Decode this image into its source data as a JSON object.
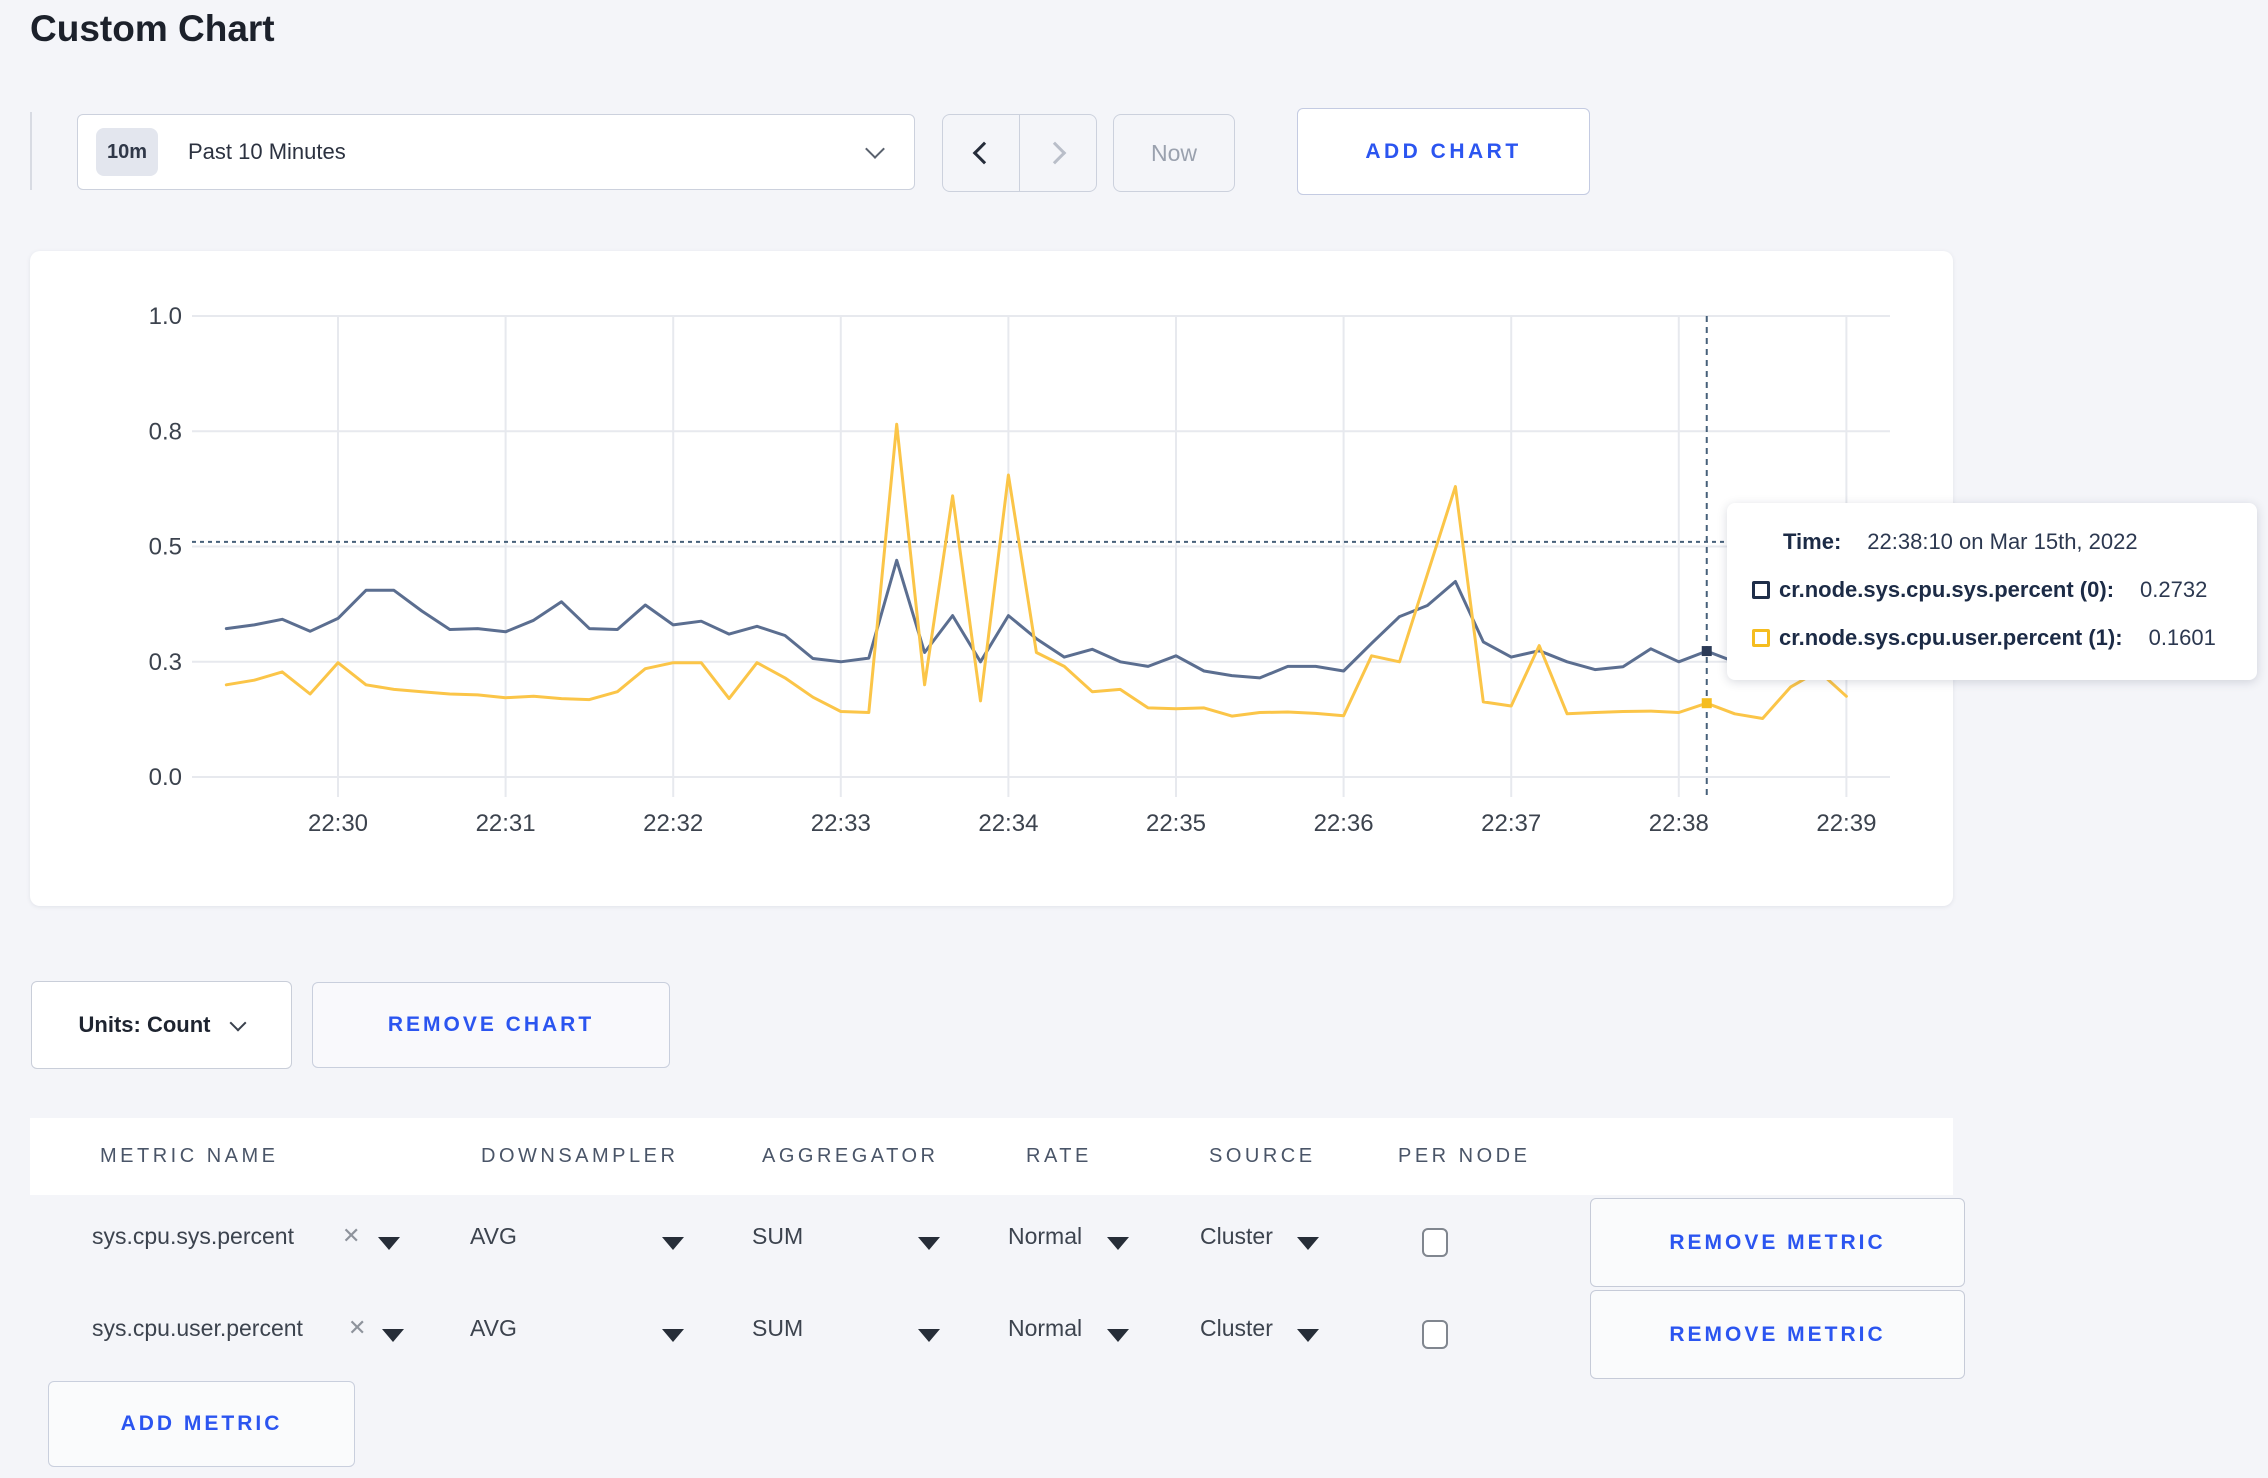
{
  "title": "Custom Chart",
  "toolbar": {
    "range_badge": "10m",
    "range_label": "Past 10 Minutes",
    "now_label": "Now",
    "add_chart_label": "ADD CHART"
  },
  "chart_data": {
    "type": "line",
    "title": "",
    "xlabel": "",
    "ylabel": "",
    "ylim": [
      0,
      1.0
    ],
    "grid": true,
    "yticks": [
      {
        "v": 0.0,
        "label": "0.0"
      },
      {
        "v": 0.25,
        "label": "0.3"
      },
      {
        "v": 0.5,
        "label": "0.5"
      },
      {
        "v": 0.75,
        "label": "0.8"
      },
      {
        "v": 1.0,
        "label": "1.0"
      }
    ],
    "xticks": [
      "22:30",
      "22:31",
      "22:32",
      "22:33",
      "22:34",
      "22:35",
      "22:36",
      "22:37",
      "22:38",
      "22:39"
    ],
    "x": [
      "22:29:20",
      "22:29:30",
      "22:29:40",
      "22:29:50",
      "22:30:00",
      "22:30:10",
      "22:30:20",
      "22:30:30",
      "22:30:40",
      "22:30:50",
      "22:31:00",
      "22:31:10",
      "22:31:20",
      "22:31:30",
      "22:31:40",
      "22:31:50",
      "22:32:00",
      "22:32:10",
      "22:32:20",
      "22:32:30",
      "22:32:40",
      "22:32:50",
      "22:33:00",
      "22:33:10",
      "22:33:20",
      "22:33:30",
      "22:33:40",
      "22:33:50",
      "22:34:00",
      "22:34:10",
      "22:34:20",
      "22:34:30",
      "22:34:40",
      "22:34:50",
      "22:35:00",
      "22:35:10",
      "22:35:20",
      "22:35:30",
      "22:35:40",
      "22:35:50",
      "22:36:00",
      "22:36:10",
      "22:36:20",
      "22:36:30",
      "22:36:40",
      "22:36:50",
      "22:37:00",
      "22:37:10",
      "22:37:20",
      "22:37:30",
      "22:37:40",
      "22:37:50",
      "22:38:00",
      "22:38:10",
      "22:38:20",
      "22:38:30",
      "22:38:40",
      "22:38:50",
      "22:39:00"
    ],
    "series": [
      {
        "name": "cr.node.sys.cpu.sys.percent",
        "color": "#5b6e90",
        "values": [
          0.322,
          0.33,
          0.342,
          0.316,
          0.344,
          0.405,
          0.405,
          0.36,
          0.32,
          0.322,
          0.315,
          0.34,
          0.38,
          0.322,
          0.32,
          0.373,
          0.33,
          0.338,
          0.31,
          0.327,
          0.307,
          0.257,
          0.25,
          0.258,
          0.47,
          0.27,
          0.35,
          0.25,
          0.35,
          0.3,
          0.26,
          0.277,
          0.25,
          0.24,
          0.263,
          0.23,
          0.22,
          0.215,
          0.24,
          0.24,
          0.23,
          0.29,
          0.348,
          0.372,
          0.424,
          0.293,
          0.26,
          0.274,
          0.25,
          0.233,
          0.239,
          0.278,
          0.25,
          0.2732,
          0.25,
          0.26,
          0.27,
          0.265,
          0.27
        ]
      },
      {
        "name": "cr.node.sys.cpu.user.percent",
        "color": "#fbc548",
        "values": [
          0.2,
          0.21,
          0.228,
          0.18,
          0.248,
          0.2,
          0.19,
          0.185,
          0.18,
          0.178,
          0.172,
          0.175,
          0.17,
          0.168,
          0.185,
          0.235,
          0.248,
          0.248,
          0.17,
          0.248,
          0.215,
          0.173,
          0.142,
          0.14,
          0.765,
          0.2,
          0.61,
          0.165,
          0.655,
          0.27,
          0.24,
          0.185,
          0.19,
          0.15,
          0.148,
          0.15,
          0.132,
          0.14,
          0.141,
          0.138,
          0.133,
          0.263,
          0.25,
          0.44,
          0.63,
          0.163,
          0.154,
          0.285,
          0.137,
          0.14,
          0.142,
          0.143,
          0.14,
          0.1601,
          0.137,
          0.127,
          0.195,
          0.23,
          0.175
        ]
      }
    ],
    "crosshair": {
      "time": "22:38:10",
      "index": 53,
      "value_line": 0.51
    }
  },
  "tooltip": {
    "time_label": "Time:",
    "time_value": "22:38:10 on Mar 15th, 2022",
    "series": [
      {
        "label": "cr.node.sys.cpu.sys.percent (0):",
        "value": "0.2732",
        "color": "#1f2e49"
      },
      {
        "label": "cr.node.sys.cpu.user.percent (1):",
        "value": "0.1601",
        "color": "#f5bd1f"
      }
    ]
  },
  "units_row": {
    "units_label": "Units: Count",
    "remove_chart_label": "REMOVE CHART"
  },
  "table": {
    "headers": [
      "METRIC NAME",
      "DOWNSAMPLER",
      "AGGREGATOR",
      "RATE",
      "SOURCE",
      "PER NODE"
    ],
    "rows": [
      {
        "metric": "sys.cpu.sys.percent",
        "downsampler": "AVG",
        "aggregator": "SUM",
        "rate": "Normal",
        "source": "Cluster",
        "per_node_checked": false,
        "remove_label": "REMOVE METRIC"
      },
      {
        "metric": "sys.cpu.user.percent",
        "downsampler": "AVG",
        "aggregator": "SUM",
        "rate": "Normal",
        "source": "Cluster",
        "per_node_checked": false,
        "remove_label": "REMOVE METRIC"
      }
    ],
    "add_metric_label": "ADD METRIC"
  }
}
